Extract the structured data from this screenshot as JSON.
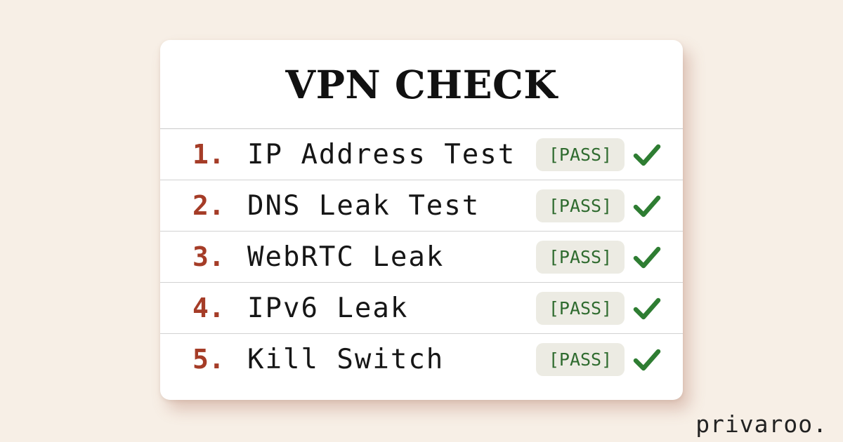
{
  "card": {
    "title": "VPN CHECK",
    "items": [
      {
        "number": "1.",
        "label": "IP Address Test",
        "status": "[PASS]"
      },
      {
        "number": "2.",
        "label": "DNS Leak Test",
        "status": "[PASS]"
      },
      {
        "number": "3.",
        "label": "WebRTC Leak",
        "status": "[PASS]"
      },
      {
        "number": "4.",
        "label": "IPv6 Leak",
        "status": "[PASS]"
      },
      {
        "number": "5.",
        "label": "Kill Switch",
        "status": "[PASS]"
      }
    ]
  },
  "brand": "privaroo.",
  "colors": {
    "background": "#f7efe6",
    "number": "#a53c27",
    "pass": "#2f6b2f",
    "check": "#2e7d32",
    "badge_bg": "#ecebe3"
  },
  "icons": {
    "status": "checkmark-icon"
  }
}
